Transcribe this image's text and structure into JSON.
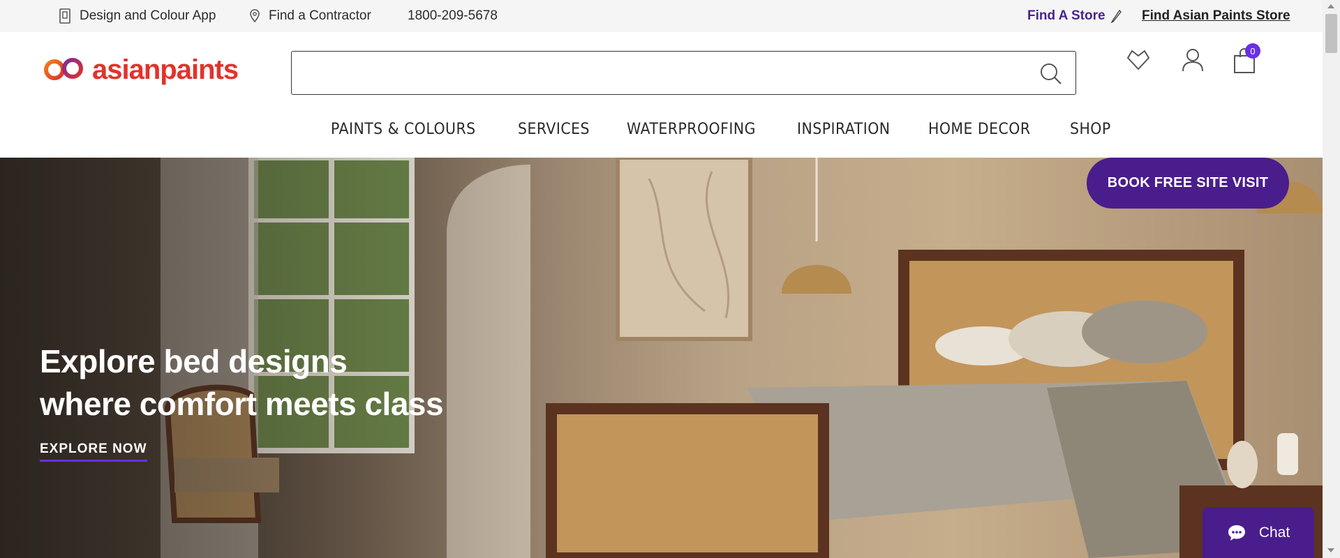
{
  "topbar": {
    "app_label": "Design and Colour App",
    "contractor_label": "Find a Contractor",
    "phone": "1800-209-5678",
    "find_store_label": "Find A Store",
    "find_ap_store_label": "Find Asian Paints Store"
  },
  "header": {
    "logo_text": "asianpaints",
    "search": {
      "value": "",
      "placeholder": ""
    },
    "cart_count": "0"
  },
  "nav": {
    "items": [
      {
        "label": "PAINTS & COLOURS"
      },
      {
        "label": "SERVICES"
      },
      {
        "label": "WATERPROOFING"
      },
      {
        "label": "INSPIRATION"
      },
      {
        "label": "HOME DECOR"
      },
      {
        "label": "SHOP"
      }
    ]
  },
  "hero": {
    "title_line1": "Explore bed designs",
    "title_line2": "where comfort meets class",
    "cta_label": "EXPLORE NOW",
    "book_label": "BOOK FREE SITE VISIT"
  },
  "chat": {
    "label": "Chat"
  },
  "colors": {
    "brand_purple": "#4a1d8c",
    "accent_purple": "#6a2ee8",
    "logo_red": "#e2332b"
  }
}
